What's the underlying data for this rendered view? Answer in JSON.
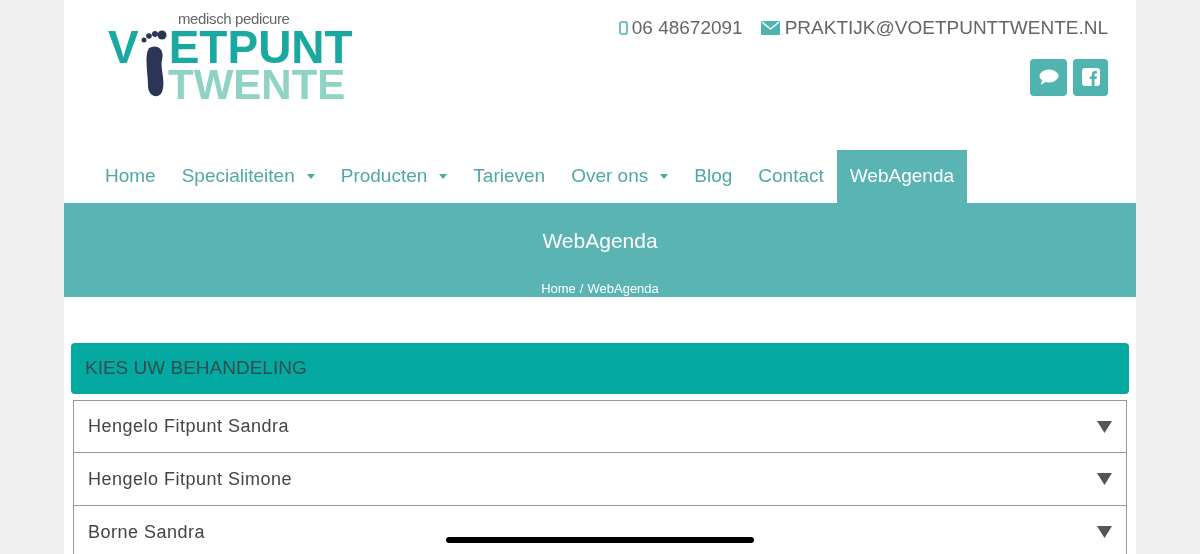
{
  "logo": {
    "tagline": "medisch pedicure",
    "line_1_start": "V",
    "line_1_end": "ETPUNT",
    "line_2": "TWENTE"
  },
  "contact": {
    "phone": "06 48672091",
    "email": "PRAKTIJK@VOETPUNTTWENTE.NL"
  },
  "nav": [
    {
      "label": "Home",
      "dropdown": false,
      "selected": false
    },
    {
      "label": "Specialiteiten",
      "dropdown": true,
      "selected": false
    },
    {
      "label": "Producten",
      "dropdown": true,
      "selected": false
    },
    {
      "label": "Tarieven",
      "dropdown": false,
      "selected": false
    },
    {
      "label": "Over ons",
      "dropdown": true,
      "selected": false
    },
    {
      "label": "Blog",
      "dropdown": false,
      "selected": false
    },
    {
      "label": "Contact",
      "dropdown": false,
      "selected": false
    },
    {
      "label": "WebAgenda",
      "dropdown": false,
      "selected": true
    }
  ],
  "banner": {
    "title": "WebAgenda",
    "breadcrumb": [
      "Home",
      "/",
      "WebAgenda"
    ]
  },
  "section": {
    "title": "KIES UW BEHANDELING",
    "items": [
      {
        "label": "Hengelo Fitpunt Sandra",
        "expanded": false
      },
      {
        "label": "Hengelo Fitpunt Simone",
        "expanded": false
      },
      {
        "label": "Borne Sandra",
        "expanded": false
      }
    ]
  }
}
